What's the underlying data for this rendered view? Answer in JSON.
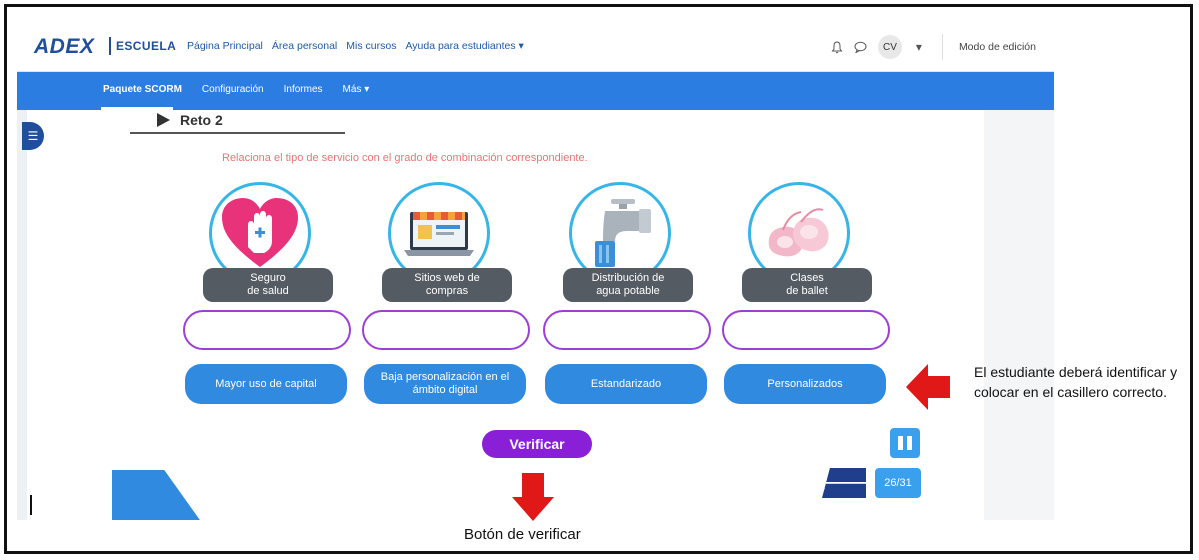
{
  "header": {
    "logo_main": "ADEX",
    "logo_sub": "ESCUELA",
    "nav": [
      "Página Principal",
      "Área personal",
      "Mis cursos",
      "Ayuda para estudiantes ▾"
    ],
    "avatar_initials": "CV",
    "edit_mode": "Modo de edición"
  },
  "subnav": {
    "items": [
      "Paquete SCORM",
      "Configuración",
      "Informes",
      "Más ▾"
    ]
  },
  "activity": {
    "title": "Reto 2",
    "instruction": "Relaciona el tipo de servicio con el grado de combinación correspondiente.",
    "cards": [
      {
        "label": "Seguro\nde salud",
        "icon": "heart-hand-icon",
        "option": "Mayor uso de capital"
      },
      {
        "label": "Sitios web de\ncompras",
        "icon": "laptop-store-icon",
        "option": "Baja personalización en el ámbito digital"
      },
      {
        "label": "Distribución de\nagua potable",
        "icon": "water-tap-icon",
        "option": "Estandarizado"
      },
      {
        "label": "Clases\nde ballet",
        "icon": "ballet-shoes-icon",
        "option": "Personalizados"
      }
    ],
    "verify_label": "Verificar",
    "page_counter": "26/31"
  },
  "annotations": {
    "side_note": "El estudiante deberá identificar y colocar en el casillero correcto.",
    "bottom_note": "Botón de verificar"
  },
  "colors": {
    "brand_blue": "#1f4f9c",
    "nav_blue": "#2b7de1",
    "option_blue": "#2f8ae0",
    "drop_border": "#9b3fd8",
    "verify_purple": "#8a1fd8",
    "arrow_red": "#e01818"
  }
}
